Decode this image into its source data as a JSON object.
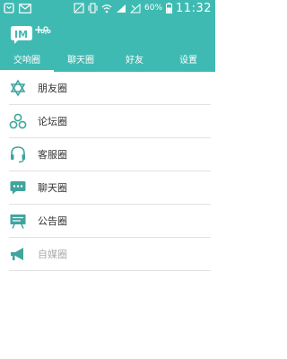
{
  "status": {
    "battery": "60%",
    "time": "11:32"
  },
  "colors": {
    "primary": "#3fbab2",
    "icon": "#3fa59d"
  },
  "tabs": [
    {
      "label": "交响圈",
      "active": true
    },
    {
      "label": "聊天圈",
      "active": false
    },
    {
      "label": "好友",
      "active": false
    },
    {
      "label": "设置",
      "active": false
    }
  ],
  "list": [
    {
      "label": "朋友圈",
      "icon": "friends-circle-icon"
    },
    {
      "label": "论坛圈",
      "icon": "forum-icon"
    },
    {
      "label": "客服圈",
      "icon": "headset-icon"
    },
    {
      "label": "聊天圈",
      "icon": "chat-bubble-icon"
    },
    {
      "label": "公告圈",
      "icon": "announcement-board-icon"
    },
    {
      "label": "自媒圈",
      "icon": "megaphone-icon",
      "disabled": true
    }
  ]
}
